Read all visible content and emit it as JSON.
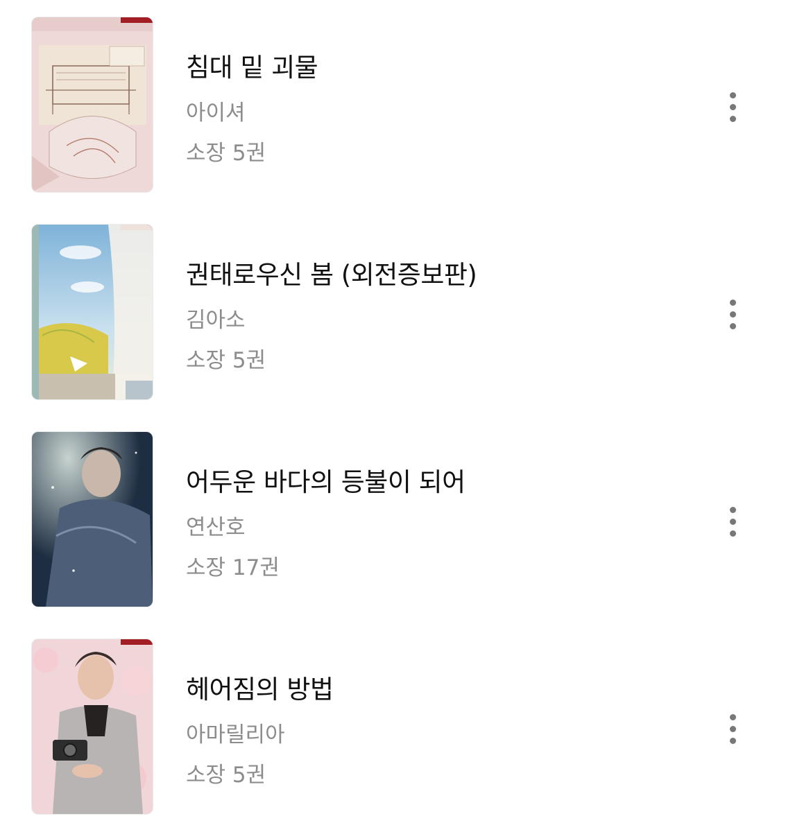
{
  "library": {
    "books": [
      {
        "title": "침대 밑 괴물",
        "author": "아이셔",
        "owned": "소장 5권",
        "menu_icon": "more-vertical-icon"
      },
      {
        "title": "권태로우신 봄 (외전증보판)",
        "author": "김아소",
        "owned": "소장 5권",
        "menu_icon": "more-vertical-icon"
      },
      {
        "title": "어두운 바다의 등불이 되어",
        "author": "연산호",
        "owned": "소장 17권",
        "menu_icon": "more-vertical-icon"
      },
      {
        "title": "헤어짐의 방법",
        "author": "아마릴리아",
        "owned": "소장 5권",
        "menu_icon": "more-vertical-icon"
      }
    ]
  }
}
